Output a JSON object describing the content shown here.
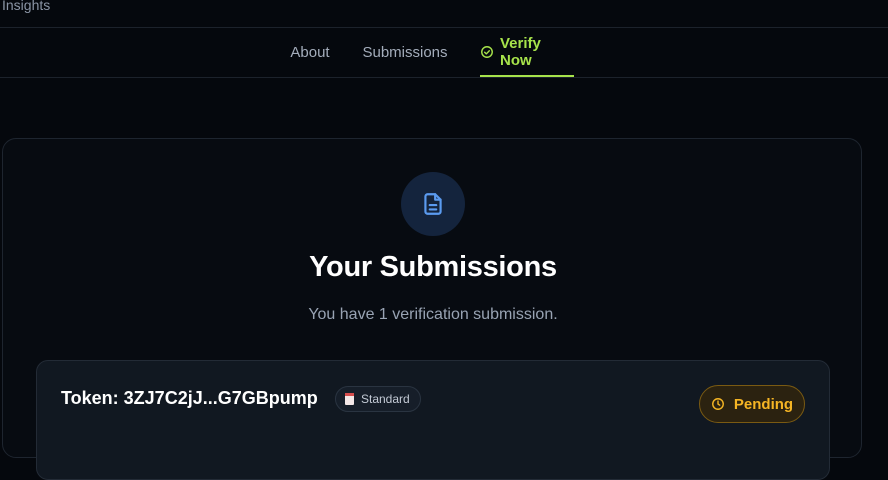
{
  "app": {
    "brand_label": "Insights"
  },
  "tabs": [
    {
      "label": "About",
      "active": false
    },
    {
      "label": "Submissions",
      "active": false
    },
    {
      "label": "Verify Now",
      "active": true,
      "icon": "check-circle-icon"
    }
  ],
  "panel": {
    "icon": "file-icon",
    "title": "Your Submissions",
    "subtitle": "You have 1 verification submission."
  },
  "submission": {
    "token_label": "Token: 3ZJ7C2jJ...G7GBpump",
    "tier_icon": "document-emoji-icon",
    "tier_label": "Standard",
    "status_icon": "clock-icon",
    "status_label": "Pending"
  },
  "colors": {
    "background": "#05080d",
    "accent_green": "#a7e34b",
    "pending_amber": "#f5b524",
    "icon_blue": "#5b9bf0"
  }
}
